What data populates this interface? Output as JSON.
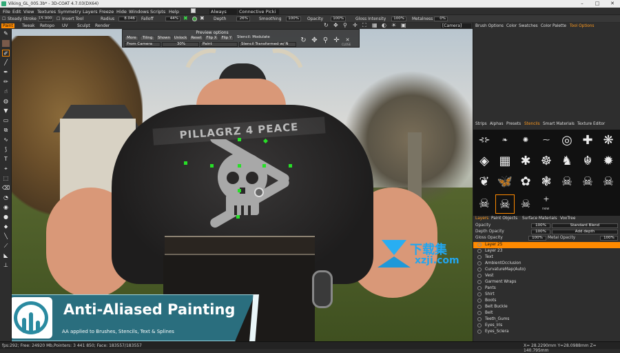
{
  "window": {
    "title": "Viking_GL_005.3b* - 3D-COAT 4.7.03(DX64)",
    "controls": [
      "–",
      "□",
      "✕"
    ]
  },
  "menu": {
    "items": [
      "File",
      "Edit",
      "View",
      "Textures",
      "Symmetry",
      "Layers",
      "Freeze",
      "Hide",
      "Windows",
      "Scripts",
      "Help"
    ],
    "mode_value": "Always",
    "connective_value": "Connective Picki"
  },
  "toolbar": {
    "steady_stroke": "Steady Stroke",
    "steady_value": "15.000",
    "invert_tool": "Invert Tool",
    "radius_label": "Radius",
    "radius_value": "8.046",
    "falloff_label": "Falloff",
    "falloff_value": "44%",
    "depth_label": "Depth",
    "depth_value": "26%",
    "smoothing_label": "Smoothing",
    "smoothing_value": "100%",
    "opacity_label": "Opacity",
    "opacity_value": "100%",
    "gloss_label": "Gloss Intensity",
    "gloss_value": "100%",
    "metalness_label": "Metalness",
    "metalness_value": "0%",
    "camera_value": "[Camera]"
  },
  "room_tabs": [
    "Paint",
    "Tweak",
    "Retopo",
    "UV",
    "Sculpt",
    "Render"
  ],
  "preview_options": {
    "title": "Preview options",
    "buttons": [
      "More",
      "Tiling",
      "Shown",
      "Unlock",
      "Reset",
      "Flip X",
      "Flip Y"
    ],
    "stencil_label": "Stencil: Modulate",
    "from_camera": "From Camera",
    "scale_value": "30%",
    "paint_value": "Paint",
    "stencil_transformed": "Stencil Transformed w/ N",
    "close_label": "CLOSE"
  },
  "vest_text": "PILLAGRZ 4 PEACE",
  "right_panel": {
    "top_tabs": [
      "Brush Options",
      "Color",
      "Swatches",
      "Color Palette",
      "Tool Options"
    ],
    "top_tabs_active": "Tool Options",
    "stencil_tabs": [
      "Strips",
      "Alphas",
      "Presets",
      "Stencils",
      "Smart Materials",
      "Texture Editor"
    ],
    "stencil_tabs_active": "Stencils",
    "stencils": [
      "⊰⊱",
      "❧",
      "✺",
      "⁓",
      "◎",
      "✚",
      "❋",
      "◈",
      "▦",
      "✱",
      "☸",
      "♞",
      "☬",
      "✹",
      "❦",
      "🦋",
      "✿",
      "❃",
      "☠",
      "☠",
      "☠",
      "☠",
      "☠"
    ],
    "new_label": "new",
    "layer_tabs": [
      "Layers",
      "Paint Objects",
      "Surface Materials",
      "VoxTree"
    ],
    "layer_tabs_active": "Layers",
    "opacity_label": "Opacity",
    "opacity_value": "100%",
    "blend_value": "Standard Blend",
    "depth_opacity_label": "Depth Opacity",
    "depth_opacity_value": "100%",
    "add_depth_value": "Add depth",
    "gloss_opacity_label": "Gloss Opacity",
    "gloss_opacity_value": "100%",
    "metal_opacity_label": "Metal Opacity",
    "metal_opacity_value": "100%",
    "layers": [
      "Layer 25",
      "Layer 23",
      "Text",
      "AmbientOcclusion",
      "CurvatureMap(Auto)",
      "Vest",
      "Garment Wraps",
      "Pants",
      "Shirt",
      "Boots",
      "Belt Buckle",
      "Belt",
      "Teeth_Gums",
      "Eyes_Iris",
      "Eyes_Sclera"
    ],
    "active_layer": "Layer 25"
  },
  "status": {
    "left": "fps:292;  Free: 24920 Mb,Pointers: 3 441 850; Face: 183557/183557",
    "right": "X= 28.2290mm  Y=28.0988mm  Z= 140.795mm"
  },
  "banner": {
    "title": "Anti-Aliased Painting",
    "subtitle": "AA applied to Brushes, Stencils, Text & Splines"
  },
  "watermark": {
    "line1": "下载集",
    "line2": "xzji.com"
  },
  "colors": {
    "accent": "#ff8a00",
    "gizmo": "#27e027",
    "banner": "#2a6e7e",
    "watermark": "#22a6f0"
  }
}
